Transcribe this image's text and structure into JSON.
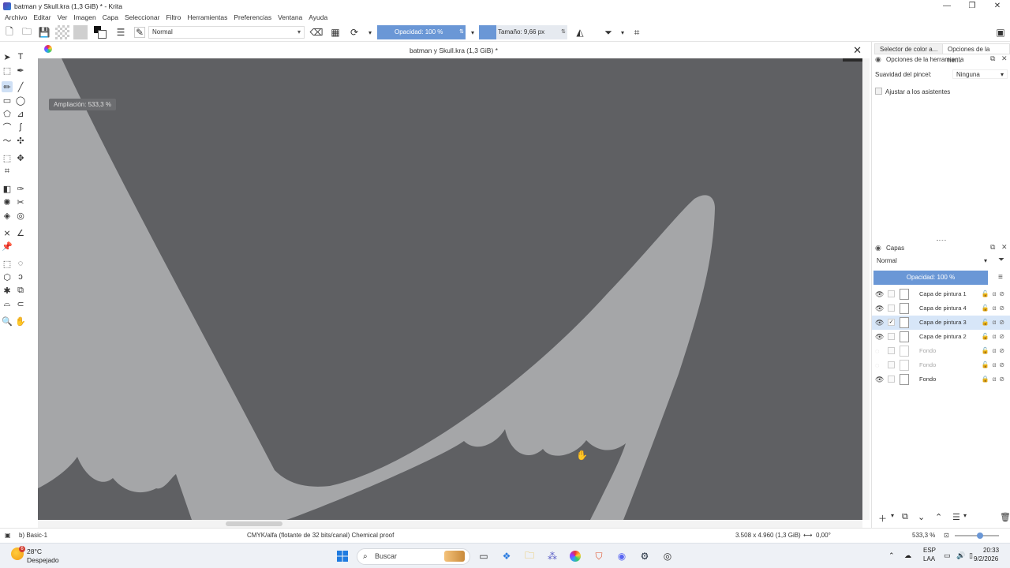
{
  "window": {
    "title": "batman y Skull.kra (1,3 GiB) * - Krita",
    "controls": [
      "—",
      "❐",
      "✕"
    ]
  },
  "menu": [
    "Archivo",
    "Editar",
    "Ver",
    "Imagen",
    "Capa",
    "Seleccionar",
    "Filtro",
    "Herramientas",
    "Preferencias",
    "Ventana",
    "Ayuda"
  ],
  "toolbar": {
    "blend_mode": "Normal",
    "opacity": "Opacidad: 100 %",
    "size": "Tamaño: 9,66 px"
  },
  "document": {
    "title": "batman y Skull.kra (1,3 GiB) *",
    "zoom_tooltip": "Ampliación: 533,3 %"
  },
  "tool_options": {
    "tab_color": "Selector de color a...",
    "tab_options": "Opciones de la her...",
    "panel_title": "Opciones de la herramienta",
    "smoothing_label": "Suavidad del pincel:",
    "smoothing_value": "Ninguna",
    "snap_label": "Ajustar a los asistentes"
  },
  "layers": {
    "panel_title": "Capas",
    "blend_mode": "Normal",
    "opacity": "Opacidad: 100 %",
    "items": [
      {
        "name": "Capa de pintura 1",
        "visible": true,
        "selected": false
      },
      {
        "name": "Capa de pintura 4",
        "visible": true,
        "selected": false
      },
      {
        "name": "Capa de pintura 3",
        "visible": true,
        "selected": true
      },
      {
        "name": "Capa de pintura 2",
        "visible": true,
        "selected": false
      },
      {
        "name": "Fondo",
        "visible": false,
        "selected": false
      },
      {
        "name": "Fondo",
        "visible": false,
        "selected": false
      },
      {
        "name": "Fondo",
        "visible": true,
        "selected": false
      }
    ]
  },
  "status": {
    "brush": "b) Basic-1",
    "color_space": "CMYK/alfa (flotante de 32 bits/canal)  Chemical proof",
    "image_size": "3.508 x 4.960 (1,3 GiB)",
    "rotation": "0,00°",
    "zoom": "533,3 %"
  },
  "taskbar": {
    "temperature": "28°C",
    "weather": "Despejado",
    "weather_badge": "6",
    "search_placeholder": "Buscar",
    "lang": "ESP",
    "lang2": "LAA",
    "time": "20:33",
    "date": "9/2/2026"
  },
  "colors": {
    "canvas_bg": "#5f6063",
    "stroke": "#a5a6a8",
    "accent": "#6a97d6"
  }
}
